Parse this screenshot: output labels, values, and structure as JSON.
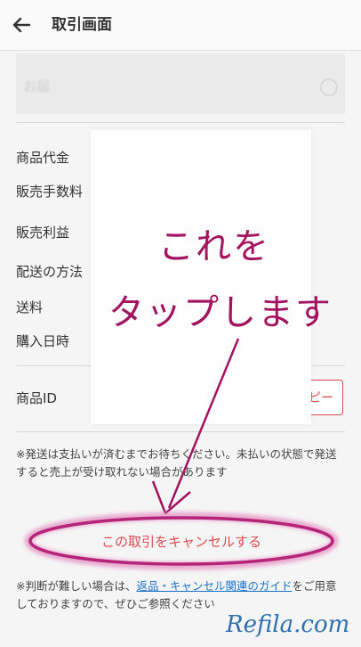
{
  "header": {
    "title": "取引画面",
    "back_icon": "arrow-left-icon"
  },
  "delivery": {
    "label": "お届"
  },
  "rows": [
    {
      "label": "商品代金"
    },
    {
      "label": "販売手数料"
    },
    {
      "label": "販売利益"
    },
    {
      "label": "配送の方法"
    },
    {
      "label": "送料"
    },
    {
      "label": "購入日時"
    },
    {
      "label": "商品ID"
    }
  ],
  "copy_button": {
    "label": "ピー"
  },
  "annotation": {
    "line1": "これを",
    "line2": "タップします",
    "color": "#a3135f"
  },
  "notice": "※発送は支払いが済むまでお待ちください。未払いの状態で発送すると売上が受け取れない場合があります",
  "cancel_button": {
    "label": "この取引をキャンセルする",
    "color": "#e04a4f"
  },
  "help": {
    "prefix": "※判断が難しい場合は、",
    "link": "返品・キャンセル関連のガイド",
    "suffix": "をご用意しておりますので、ぜひご参照ください"
  },
  "watermark": "Refila.com"
}
